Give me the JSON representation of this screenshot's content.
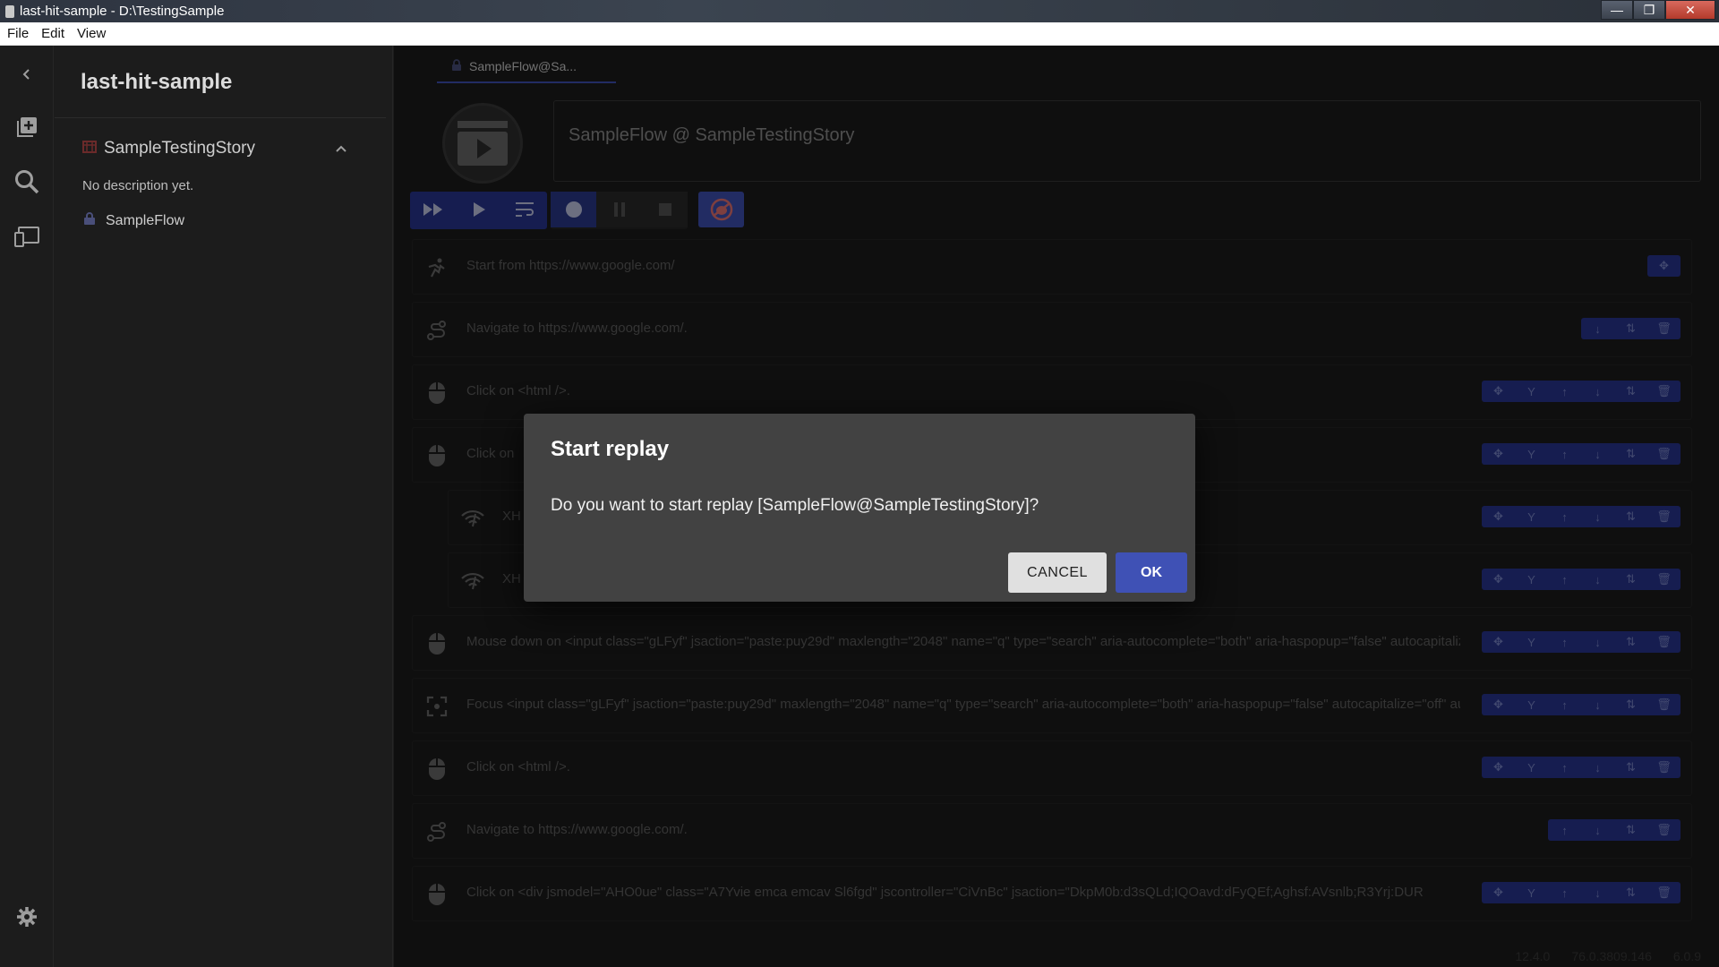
{
  "window": {
    "title": "last-hit-sample - D:\\TestingSample",
    "minimize": "—",
    "maximize": "❐",
    "close": "✕"
  },
  "menu": [
    "File",
    "Edit",
    "View"
  ],
  "sidebar": {
    "project_title": "last-hit-sample",
    "story_name": "SampleTestingStory",
    "story_description": "No description yet.",
    "flow_name": "SampleFlow"
  },
  "main": {
    "tab_label": "SampleFlow@Sa...",
    "flow_full_name": "SampleFlow @ SampleTestingStory"
  },
  "steps": [
    {
      "icon": "start-icon",
      "text": "Start from https://www.google.com/"
    },
    {
      "icon": "navigate-icon",
      "text": "Navigate to https://www.google.com/."
    },
    {
      "icon": "mouse-icon",
      "text": "Click on <html />."
    },
    {
      "icon": "mouse-icon",
      "text": "Click on"
    },
    {
      "icon": "wifi-icon",
      "text": "XH"
    },
    {
      "icon": "wifi-icon",
      "text": "XH"
    },
    {
      "icon": "mouse-icon",
      "text": "Mouse down on <input class=\"gLFyf\" jsaction=\"paste:puy29d\" maxlength=\"2048\" name=\"q\" type=\"search\" aria-autocomplete=\"both\" aria-haspopup=\"false\" autocapitalize=\"off\" autocomplete=\"off\" autocorrect=\"off\""
    },
    {
      "icon": "focus-icon",
      "text": "Focus <input class=\"gLFyf\" jsaction=\"paste:puy29d\" maxlength=\"2048\" name=\"q\" type=\"search\" aria-autocomplete=\"both\" aria-haspopup=\"false\" autocapitalize=\"off\" autocomplete=\"off\""
    },
    {
      "icon": "mouse-icon",
      "text": "Click on <html />."
    },
    {
      "icon": "navigate-icon",
      "text": "Navigate to https://www.google.com/."
    },
    {
      "icon": "mouse-icon",
      "text": "Click on <div jsmodel=\"AHO0ue\" class=\"A7Yvie emca emcav Sl6fgd\" jscontroller=\"CiVnBc\" jsaction=\"DkpM0b:d3sQLd;IQOavd:dFyQEf;Aghsf:AVsnlb;R3Yrj:DUR"
    }
  ],
  "dialog": {
    "title": "Start replay",
    "message": "Do you want to start replay [SampleFlow@SampleTestingStory]?",
    "cancel_label": "CANCEL",
    "ok_label": "OK"
  },
  "status": {
    "app_version": "12.4.0",
    "chrome_version": "76.0.3809.146",
    "electron_version": "6.0.9"
  },
  "colors": {
    "accent": "#3f51b5",
    "accent_dark": "#283593",
    "background": "#1c1c1c",
    "dialog": "#424242"
  }
}
